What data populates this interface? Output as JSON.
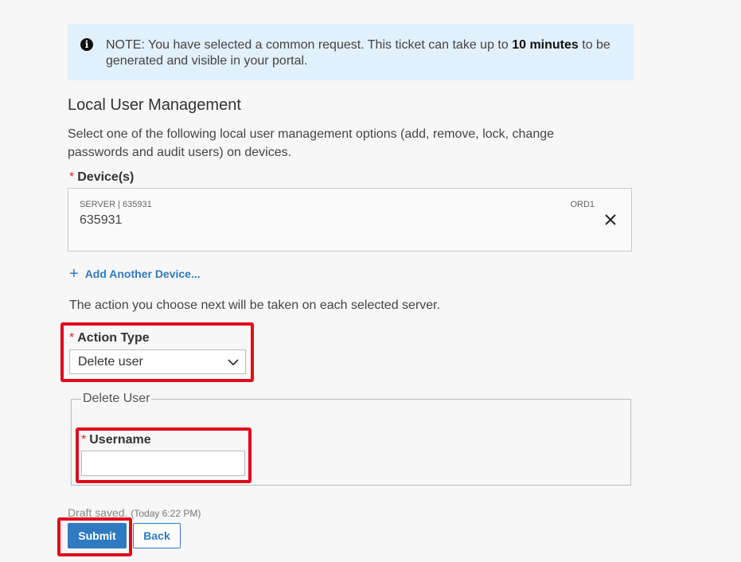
{
  "note": {
    "prefix": "NOTE:",
    "text_before": " You have selected a common request. This ticket can take up to ",
    "bold": "10 minutes",
    "text_after": " to be generated and visible in your portal."
  },
  "section": {
    "title": "Local User Management",
    "description": "Select one of the following local user management options (add, remove, lock, change passwords and audit users) on devices."
  },
  "devices": {
    "label": "Device(s)",
    "required_mark": "*",
    "items": [
      {
        "meta": "SERVER | 635931",
        "region": "ORD1",
        "id": "635931"
      }
    ],
    "add_label": "Add Another Device..."
  },
  "action_note": "The action you choose next will be taken on each selected server.",
  "action_type": {
    "label": "Action Type",
    "required_mark": "*",
    "selected": "Delete user"
  },
  "delete_user": {
    "legend": "Delete User",
    "username_label": "Username",
    "required_mark": "*",
    "username_value": ""
  },
  "draft": {
    "text": "Draft saved.",
    "time": "(Today 6:22 PM)"
  },
  "buttons": {
    "submit": "Submit",
    "back": "Back"
  },
  "colors": {
    "accent": "#2f7ac0",
    "note_bg": "#e1f0fb",
    "highlight": "#e00b1c",
    "required": "#d9271e"
  }
}
